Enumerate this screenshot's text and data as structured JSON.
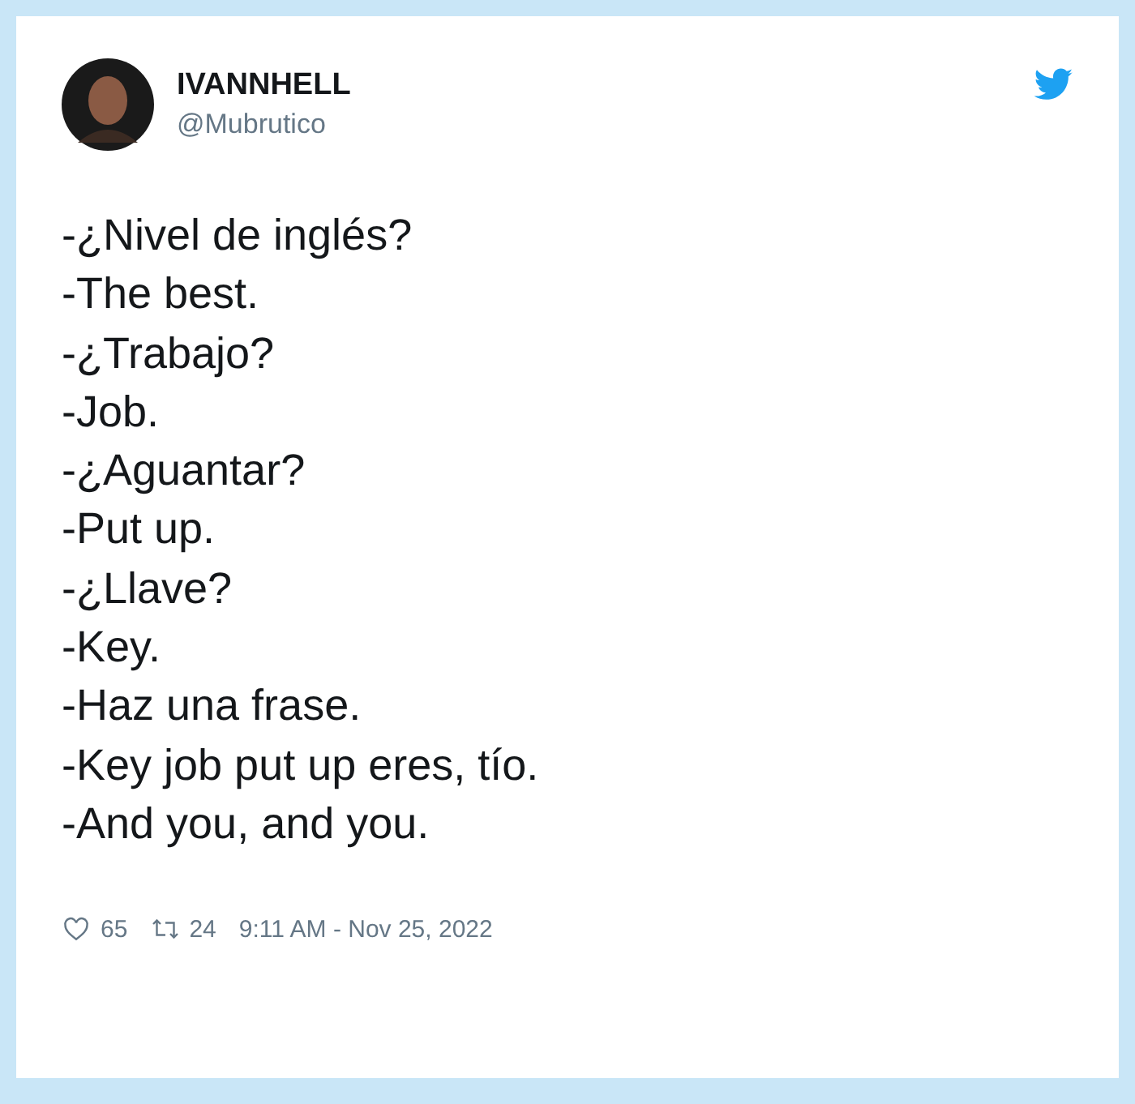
{
  "author": {
    "name": "IVANNHELL",
    "handle": "@Mubrutico"
  },
  "lines": [
    "-¿Nivel de inglés?",
    "-The best.",
    "-¿Trabajo?",
    "-Job.",
    "-¿Aguantar?",
    "-Put up.",
    "-¿Llave?",
    "-Key.",
    "-Haz una frase.",
    "-Key job put up eres, tío.",
    "-And you, and you."
  ],
  "footer": {
    "likes": "65",
    "retweets": "24",
    "timestamp": "9:11 AM - Nov 25, 2022"
  }
}
